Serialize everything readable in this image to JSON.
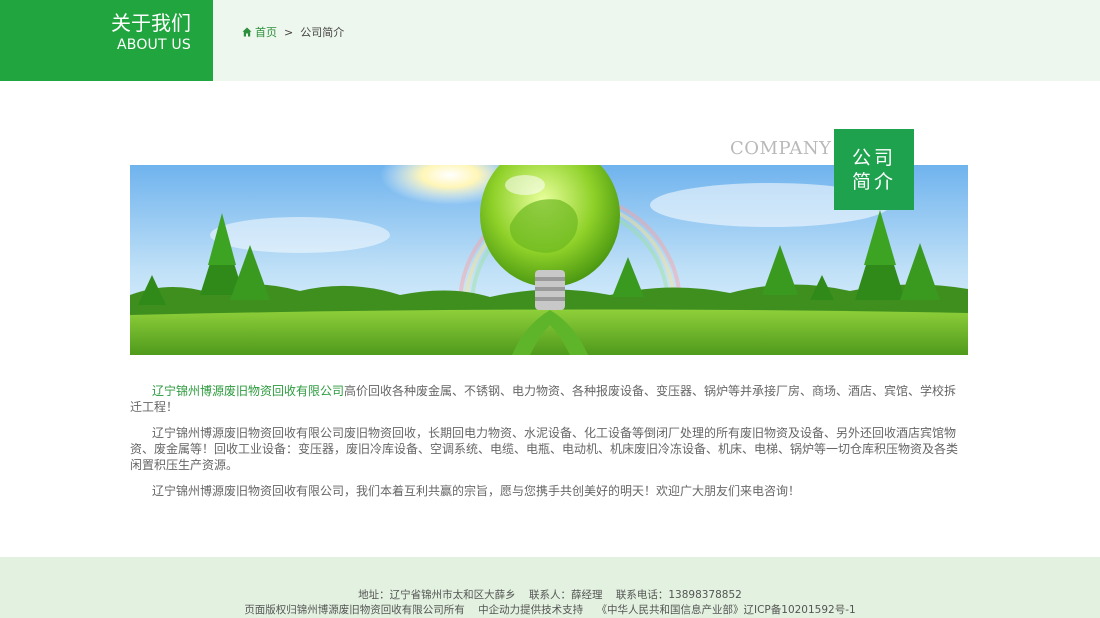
{
  "header": {
    "title_cn": "关于我们",
    "title_en": "ABOUT US",
    "breadcrumb": {
      "home": "首页",
      "separator": ">",
      "current": "公司简介"
    }
  },
  "section": {
    "label_en": "COMPANY",
    "label_cn_1": "公司",
    "label_cn_2": "简介"
  },
  "content": {
    "p1_company": "辽宁锦州博源废旧物资回收有限公司",
    "p1_rest": "高价回收各种废金属、不锈钢、电力物资、各种报废设备、变压器、锅炉等并承接厂房、商场、酒店、宾馆、学校拆迁工程！",
    "p2": "辽宁锦州博源废旧物资回收有限公司废旧物资回收，长期回电力物资、水泥设备、化工设备等倒闭厂处理的所有废旧物资及设备、另外还回收酒店宾馆物资、废金属等！回收工业设备：变压器，废旧冷库设备、空调系统、电缆、电瓶、电动机、机床废旧冷冻设备、机床、电梯、锅炉等一切仓库积压物资及各类闲置积压生产资源。",
    "p3": "辽宁锦州博源废旧物资回收有限公司，我们本着互利共赢的宗旨，愿与您携手共创美好的明天！欢迎广大朋友们来电咨询！"
  },
  "footer": {
    "address": "地址：辽宁省锦州市太和区大薛乡",
    "contact": "联系人：薛经理",
    "phone": "联系电话：13898378852",
    "copyright": "页面版权归锦州博源废旧物资回收有限公司所有",
    "support": "中企动力提供技术支持",
    "icp": "《中华人民共和国信息产业部》辽ICP备10201592号-1"
  },
  "colors": {
    "brand_green": "#21a53f",
    "header_bg": "#eef7ee",
    "footer_bg": "#e3f2e0",
    "highlight": "#2c9b3e"
  },
  "icons": {
    "breadcrumb_home": "home-icon"
  }
}
